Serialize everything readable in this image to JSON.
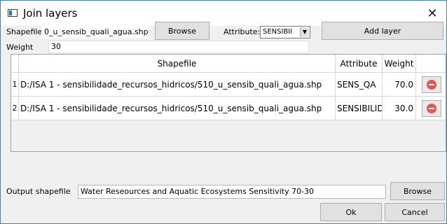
{
  "window": {
    "title": "Join layers"
  },
  "form": {
    "shapefile_label": "Shapefile",
    "shapefile_value": "0_u_sensib_quali_agua.shp",
    "browse_label": "Browse",
    "attribute_label": "Attribute:",
    "attribute_value": "SENSIBII",
    "weight_label": "Weight",
    "weight_value": "30",
    "add_layer_label": "Add layer"
  },
  "table": {
    "columns": [
      "Shapefile",
      "Attribute",
      "Weight"
    ],
    "rows": [
      {
        "num": "1",
        "shapefile": "D:/ISA 1 - sensibilidade_recursos_hidricos/510_u_sensib_quali_agua.shp",
        "attribute": "SENS_QA",
        "weight": "70.0"
      },
      {
        "num": "2",
        "shapefile": "D:/ISA 1 - sensibilidade_recursos_hidricos/510_u_sensib_quali_agua.shp",
        "attribute": "SENSIBILID",
        "weight": "30.0"
      }
    ]
  },
  "output": {
    "label": "Output shapefile",
    "value": "Water Reseources and Aquatic Ecosystems Sensitivity 70-30",
    "browse_label": "Browse"
  },
  "footer": {
    "ok_label": "Ok",
    "cancel_label": "Cancel"
  },
  "colors": {
    "accent": "#4a7ebb",
    "remove": "#e8554e"
  }
}
